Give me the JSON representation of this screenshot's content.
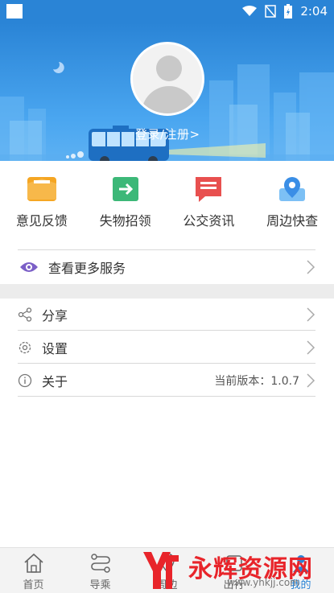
{
  "status_bar": {
    "time": "2:04"
  },
  "header": {
    "login_text": "登录/注册>"
  },
  "quick_services": [
    {
      "label": "意见反馈",
      "icon": "envelope-icon",
      "color": "#f5a623"
    },
    {
      "label": "失物招领",
      "icon": "wallet-arrow-icon",
      "color": "#3cb878"
    },
    {
      "label": "公交资讯",
      "icon": "message-icon",
      "color": "#e8504f"
    },
    {
      "label": "周边快查",
      "icon": "map-pin-icon",
      "color": "#3a8ee6"
    }
  ],
  "more_services": {
    "label": "查看更多服务"
  },
  "menu": {
    "share": {
      "label": "分享"
    },
    "settings": {
      "label": "设置"
    },
    "about": {
      "label": "关于",
      "value": "当前版本：1.0.7"
    }
  },
  "bottom_nav": [
    {
      "label": "首页",
      "icon": "home-icon"
    },
    {
      "label": "导乘",
      "icon": "route-icon"
    },
    {
      "label": "周边",
      "icon": "nearby-icon"
    },
    {
      "label": "出行",
      "icon": "travel-icon"
    },
    {
      "label": "我的",
      "icon": "user-icon"
    }
  ],
  "watermark": {
    "brand": "永辉资源网",
    "url": "www.yhkjj.com"
  },
  "colors": {
    "primary": "#2a84d6",
    "divider": "#d8d8d8",
    "band": "#ececec"
  }
}
